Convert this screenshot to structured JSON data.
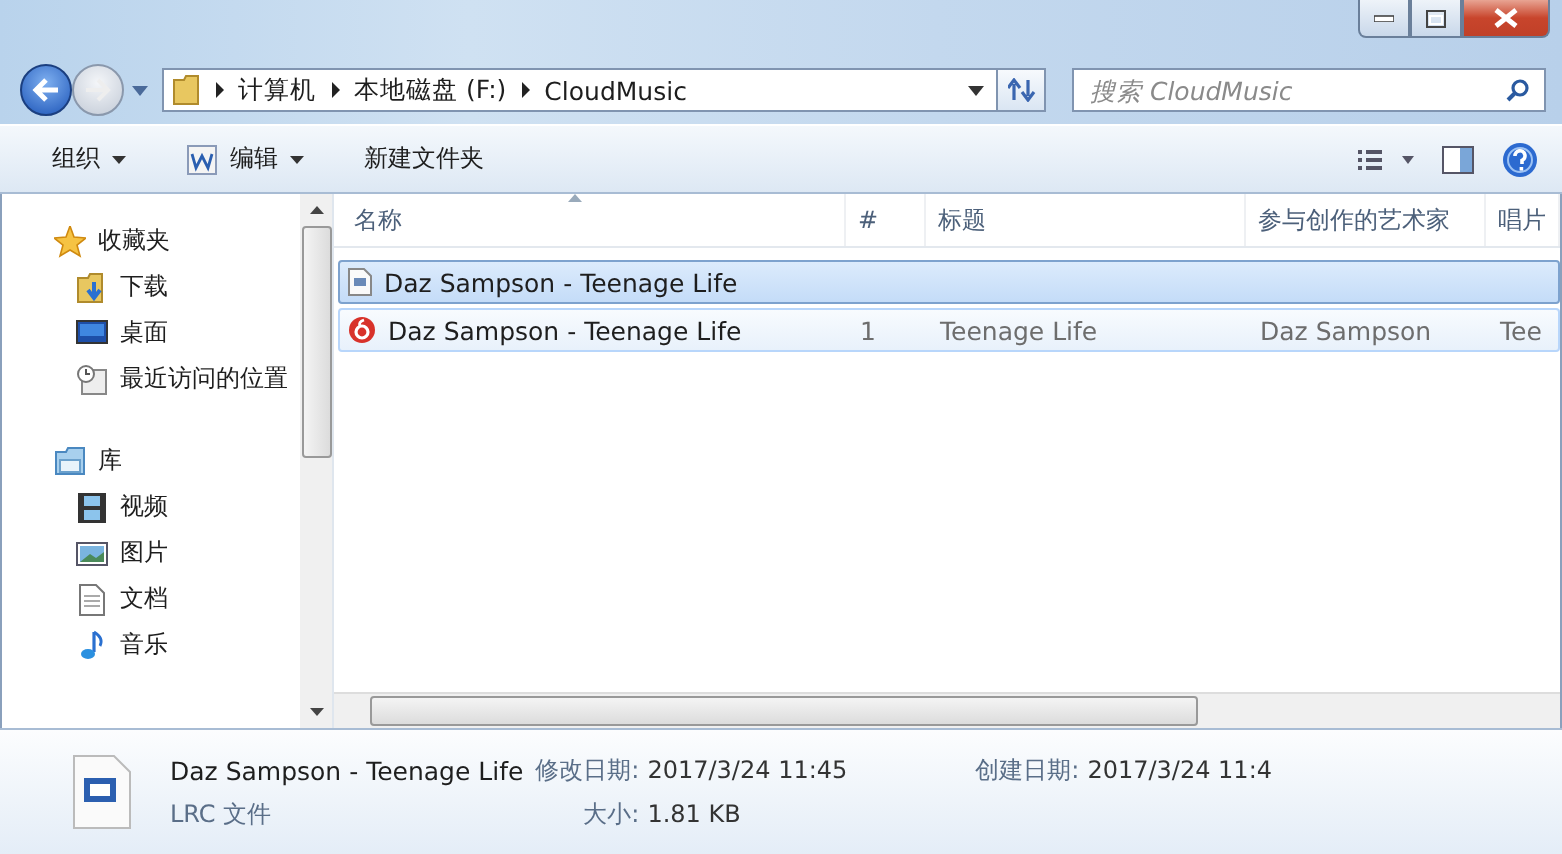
{
  "address": {
    "segments": [
      "计算机",
      "本地磁盘 (F:)",
      "CloudMusic"
    ]
  },
  "search": {
    "placeholder": "搜索 CloudMusic"
  },
  "toolbar": {
    "items": [
      {
        "label": "组织",
        "kind": "menu"
      },
      {
        "label": "编辑",
        "kind": "app-menu"
      },
      {
        "label": "新建文件夹",
        "kind": "plain"
      }
    ]
  },
  "sidebar": {
    "groups": [
      {
        "label": "收藏夹",
        "kind": "star",
        "children": [
          {
            "label": "下载",
            "kind": "download"
          },
          {
            "label": "桌面",
            "kind": "desktop"
          },
          {
            "label": "最近访问的位置",
            "kind": "recent"
          }
        ]
      },
      {
        "label": "库",
        "kind": "library",
        "children": [
          {
            "label": "视频",
            "kind": "video"
          },
          {
            "label": "图片",
            "kind": "picture"
          },
          {
            "label": "文档",
            "kind": "document"
          },
          {
            "label": "音乐",
            "kind": "music"
          }
        ]
      }
    ]
  },
  "table": {
    "columns": [
      "名称",
      "#",
      "标题",
      "参与创作的艺术家",
      "唱片"
    ],
    "rows": [
      {
        "kind": "lrc",
        "selected": true,
        "hovered": false,
        "cells": [
          "Daz Sampson - Teenage Life"
        ]
      },
      {
        "kind": "audio",
        "selected": false,
        "hovered": true,
        "cells": [
          "Daz Sampson - Teenage Life",
          "1",
          "Teenage Life",
          "Daz Sampson",
          "Tee"
        ]
      }
    ]
  },
  "details": {
    "name": "Daz Sampson - Teenage Life",
    "type": "LRC 文件",
    "fields": [
      {
        "label": "修改日期:",
        "value": "2017/3/24 11:45"
      },
      {
        "label": "创建日期:",
        "value": "2017/3/24 11:4"
      },
      {
        "label": "大小:",
        "value": "1.81 KB"
      }
    ]
  }
}
